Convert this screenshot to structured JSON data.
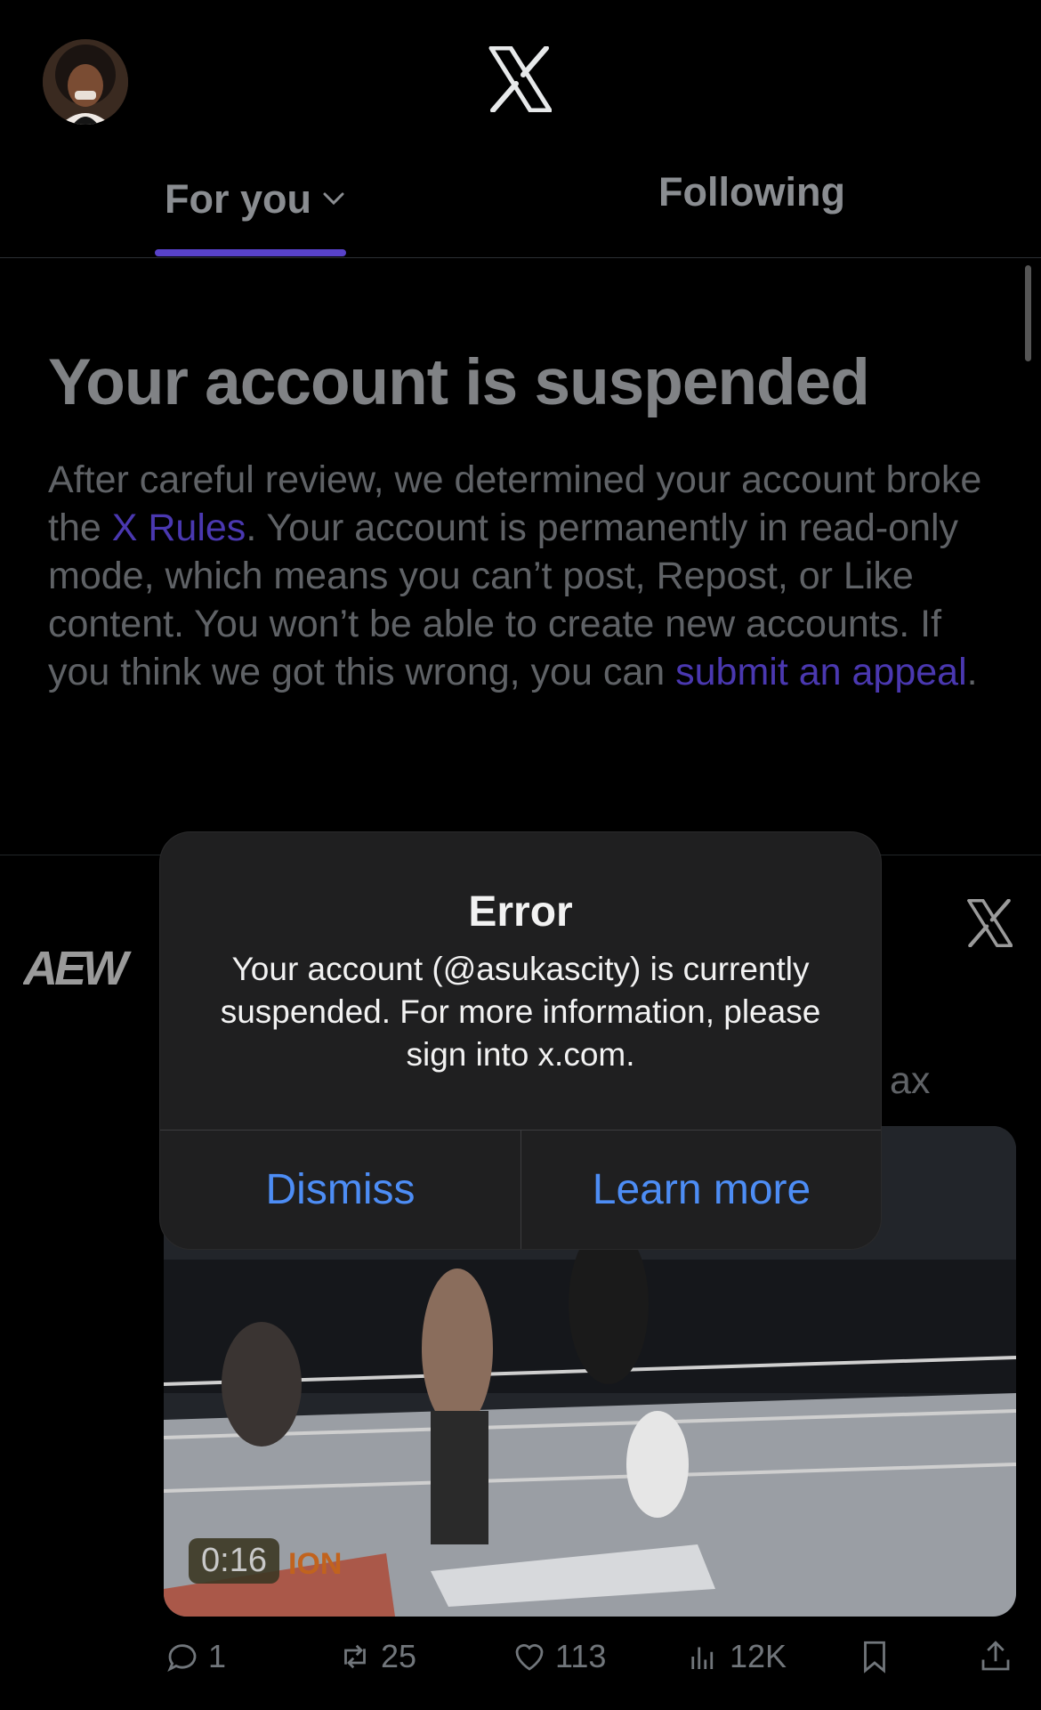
{
  "header": {
    "tabs": [
      {
        "label": "For you",
        "active": true
      },
      {
        "label": "Following",
        "active": false
      }
    ]
  },
  "notice": {
    "title": "Your account is suspended",
    "body_part1": "After careful review, we determined your account broke the ",
    "rules_link": "X Rules",
    "body_part2": ". Your account is permanently in read-only mode, which means you can’t post, Repost, or Like content. You won’t be able to create new accounts. If you think we got this wrong, you can ",
    "appeal_link": "submit an appeal",
    "body_part3": "."
  },
  "tweet": {
    "author_logo": "AEW",
    "text_fragment": "ax",
    "video": {
      "timestamp": "0:16",
      "watermark": "ION"
    },
    "actions": {
      "replies": "1",
      "reposts": "25",
      "likes": "113",
      "views": "12K"
    }
  },
  "alert": {
    "title": "Error",
    "message": "Your account (@asukascity) is currently suspended. For more information, please sign into x.com.",
    "dismiss_label": "Dismiss",
    "learn_more_label": "Learn more"
  },
  "colors": {
    "accent": "#5842c9",
    "link": "#4a38b0",
    "alert_button": "#4d8df5",
    "background": "#000000"
  }
}
